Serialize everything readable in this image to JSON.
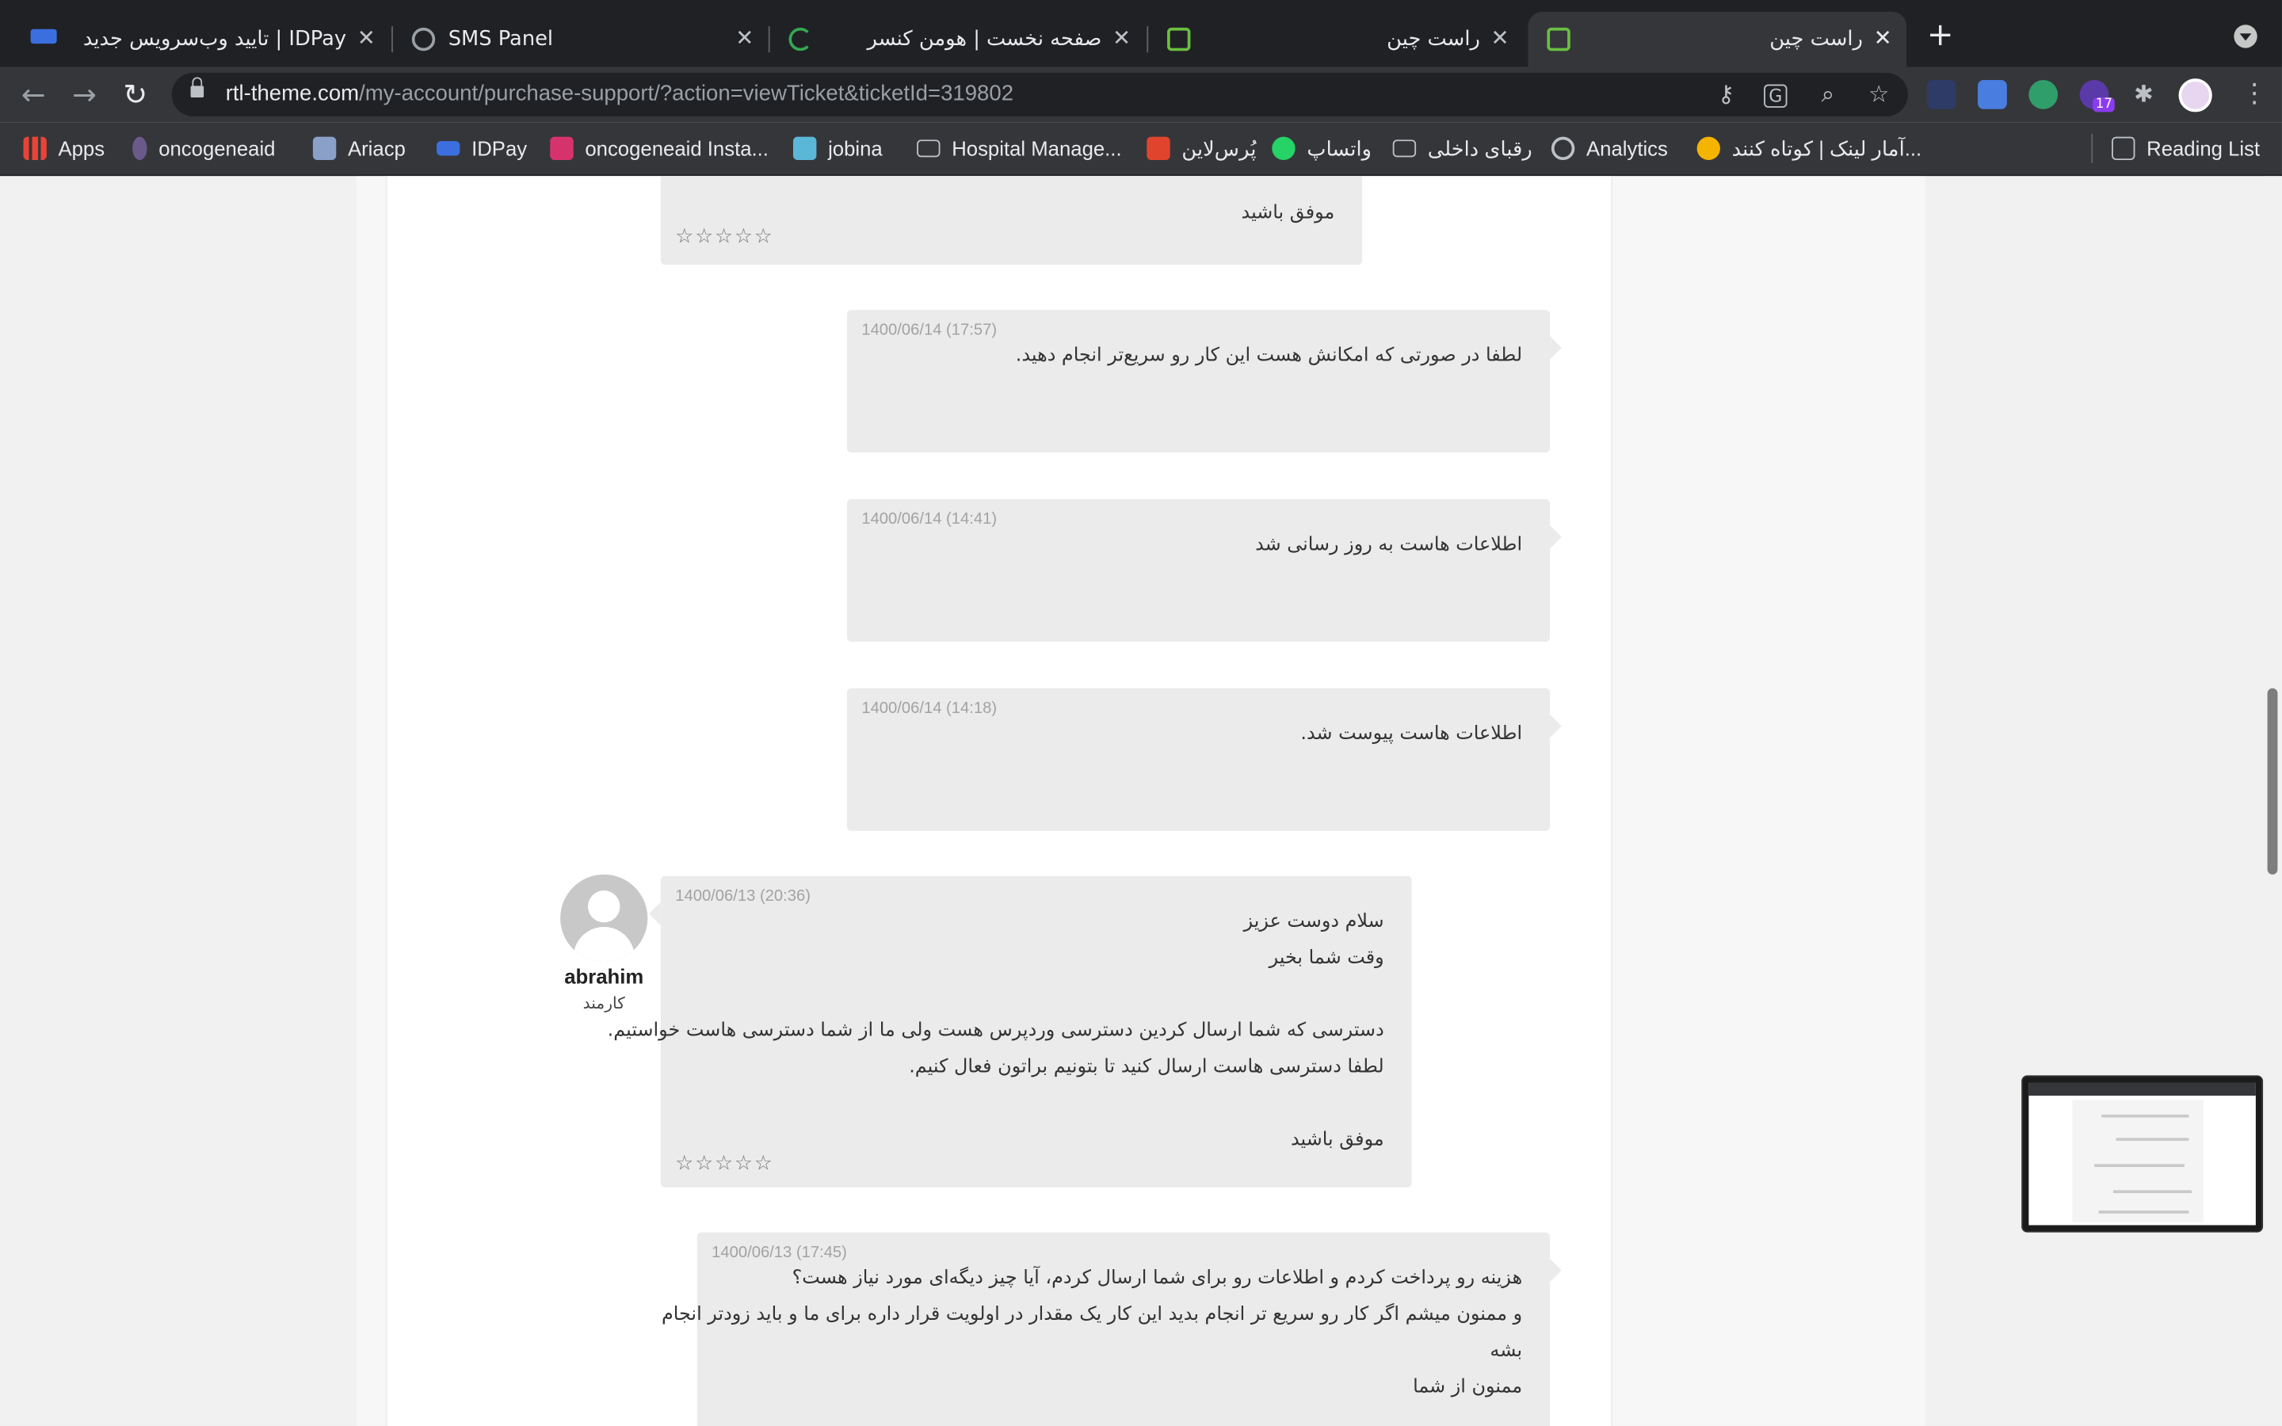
{
  "browser": {
    "tabs": [
      {
        "title": "تایید وب‌سرویس جدید | IDPay",
        "active": false
      },
      {
        "title": "SMS Panel",
        "active": false
      },
      {
        "title": "صفحه نخست | هومن کنسر",
        "active": false
      },
      {
        "title": "",
        "active": false
      },
      {
        "title": "راست چین",
        "active": false
      },
      {
        "title": "راست چین",
        "active": true
      }
    ],
    "url_domain": "rtl-theme.com",
    "url_path": "/my-account/purchase-support/?action=viewTicket&ticketId=319802",
    "extension_badge": "17",
    "bookmarks": [
      {
        "label": "Apps",
        "icon": "apps-grid-icon"
      },
      {
        "label": "oncogeneaid",
        "icon": "oncogeneaid-icon"
      },
      {
        "label": "Ariacp",
        "icon": "ariacp-icon"
      },
      {
        "label": "IDPay",
        "icon": "idpay-icon"
      },
      {
        "label": "oncogeneaid Insta...",
        "icon": "instagram-icon"
      },
      {
        "label": "jobina",
        "icon": "jobina-icon"
      },
      {
        "label": "Hospital Manage...",
        "icon": "folder-icon"
      },
      {
        "label": "پُرس‌لاین",
        "icon": "porsline-icon"
      },
      {
        "label": "واتساپ",
        "icon": "whatsapp-icon"
      },
      {
        "label": "رقبای داخلی",
        "icon": "folder-icon"
      },
      {
        "label": "Analytics",
        "icon": "globe-icon"
      },
      {
        "label": "آمار لینک | کوتاه کنند...",
        "icon": "link-stats-icon"
      }
    ],
    "reading_list": "Reading List"
  },
  "ticket": {
    "top_bubble": {
      "lines": [
        "موفق باشید"
      ],
      "stars": "☆☆☆☆☆"
    },
    "messages": [
      {
        "date": "1400/06/14 (17:57)",
        "lines": [
          "لطفا در صورتی که امکانش هست این کار رو سریع‌تر انجام دهید."
        ]
      },
      {
        "date": "1400/06/14 (14:41)",
        "lines": [
          "اطلاعات هاست به روز رسانی شد"
        ]
      },
      {
        "date": "1400/06/14 (14:18)",
        "lines": [
          "اطلاعات هاست پیوست شد."
        ]
      }
    ],
    "staff_reply": {
      "date": "1400/06/13 (20:36)",
      "user": "abrahim",
      "role": "کارمند",
      "lines": [
        "سلام دوست عزیز",
        "وقت شما بخیر",
        "دسترسی که شما ارسال کردین دسترسی وردپرس هست ولی ما از شما دسترسی هاست خواستیم.",
        "لطفا دسترسی هاست ارسال کنید تا بتونیم براتون فعال کنیم.",
        "موفق باشید"
      ],
      "stars": "☆☆☆☆☆"
    },
    "last_message": {
      "date": "1400/06/13 (17:45)",
      "lines": [
        "هزینه رو پرداخت کردم و اطلاعات رو برای شما ارسال کردم، آیا چیز دیگه‌ای مورد نیاز هست؟",
        "و ممنون میشم اگر کار رو سریع تر انجام بدید این کار یک مقدار در اولویت قرار داره برای ما و باید زودتر انجام",
        "بشه",
        "ممنون از شما"
      ]
    }
  }
}
